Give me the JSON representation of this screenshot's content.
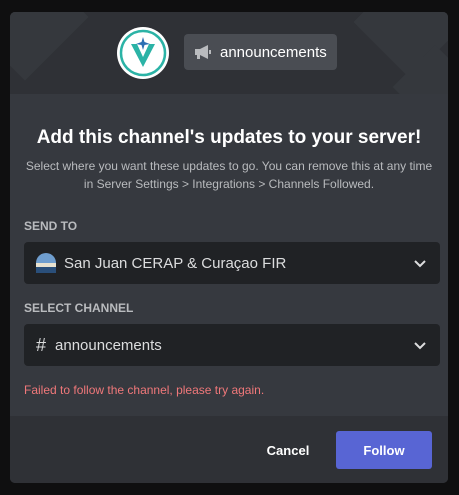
{
  "banner": {
    "channel_name": "announcements",
    "logo_letter": "V",
    "logo_icon": "airplane-icon",
    "channel_icon": "megaphone-icon"
  },
  "modal": {
    "title": "Add this channel's updates to your server!",
    "description": "Select where you want these updates to go. You can remove this at any time in Server Settings > Integrations > Channels Followed."
  },
  "send_to": {
    "label": "SEND TO",
    "selected_server": "San Juan CERAP & Curaçao FIR",
    "icon": "server-avatar-icon"
  },
  "select_channel": {
    "label": "SELECT CHANNEL",
    "selected_channel": "announcements",
    "prefix": "#"
  },
  "error_message": "Failed to follow the channel, please try again.",
  "footer": {
    "cancel_label": "Cancel",
    "follow_label": "Follow"
  },
  "colors": {
    "follow_button": "#5865d4",
    "error_text": "#f0787a",
    "modal_bg": "#36393f",
    "select_bg": "#202225"
  }
}
